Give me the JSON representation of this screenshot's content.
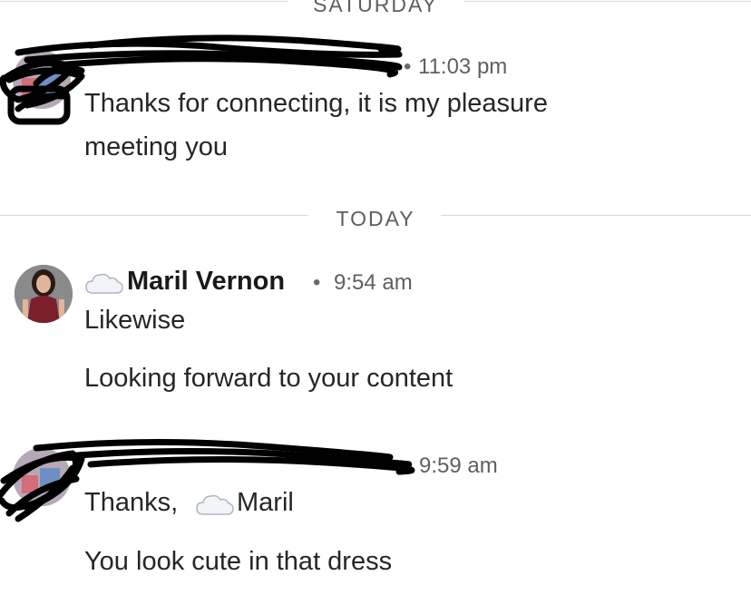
{
  "dividers": {
    "saturday": "SATURDAY",
    "today": "TODAY"
  },
  "messages": [
    {
      "sender": "",
      "time": "11:03 pm",
      "lines": [
        "Thanks for connecting, it is my pleasure",
        "meeting you"
      ]
    },
    {
      "sender": "Maril Vernon",
      "time": "9:54 am",
      "lines": [
        "Likewise",
        "Looking forward to your content"
      ]
    },
    {
      "sender": "",
      "time": "9:59 am",
      "lines": [
        "Thanks,",
        "Maril",
        "You look cute in that dress"
      ]
    }
  ],
  "icons": {
    "cloud": "cloud-emoji-icon",
    "separator": "•"
  },
  "colors": {
    "divider_line": "#d8d8d8",
    "text": "#262626",
    "redaction": "#000000",
    "dress": "#7a1f2b"
  }
}
